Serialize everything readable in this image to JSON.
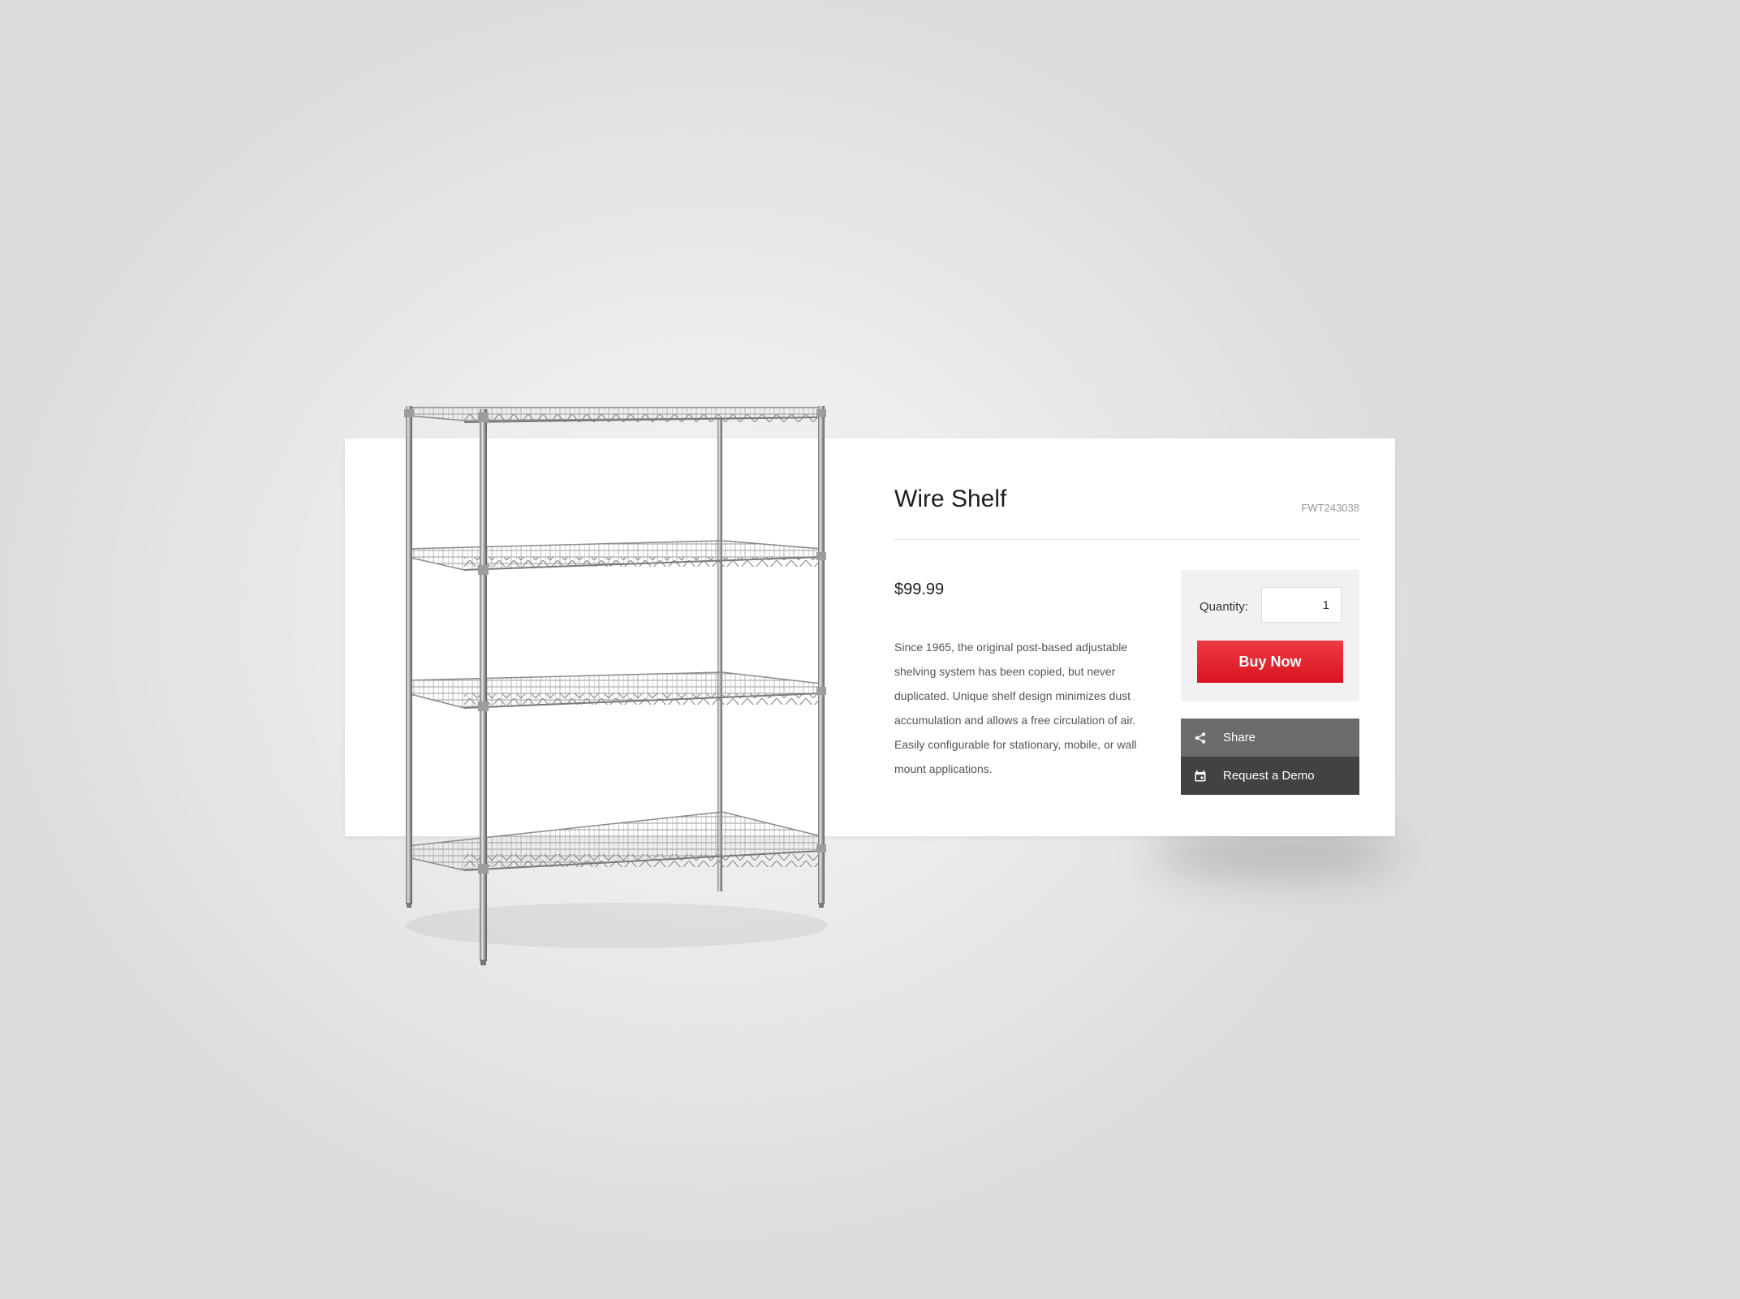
{
  "product": {
    "title": "Wire Shelf",
    "sku": "FWT243038",
    "price": "$99.99",
    "description": "Since 1965, the original post-based adjustable shelving system has been copied, but never duplicated. Unique shelf design minimizes dust accumulation and allows a free circulation of air. Easily configurable for stationary, mobile, or wall mount applications."
  },
  "purchase": {
    "quantity_label": "Quantity:",
    "quantity_value": "1",
    "buy_label": "Buy Now"
  },
  "actions": {
    "share_label": "Share",
    "share_icon": "share-icon",
    "demo_label": "Request a Demo",
    "demo_icon": "calendar-icon"
  },
  "colors": {
    "buy_button": "#e41e2b",
    "share_bg": "#6b6b6b",
    "demo_bg": "#424242"
  }
}
